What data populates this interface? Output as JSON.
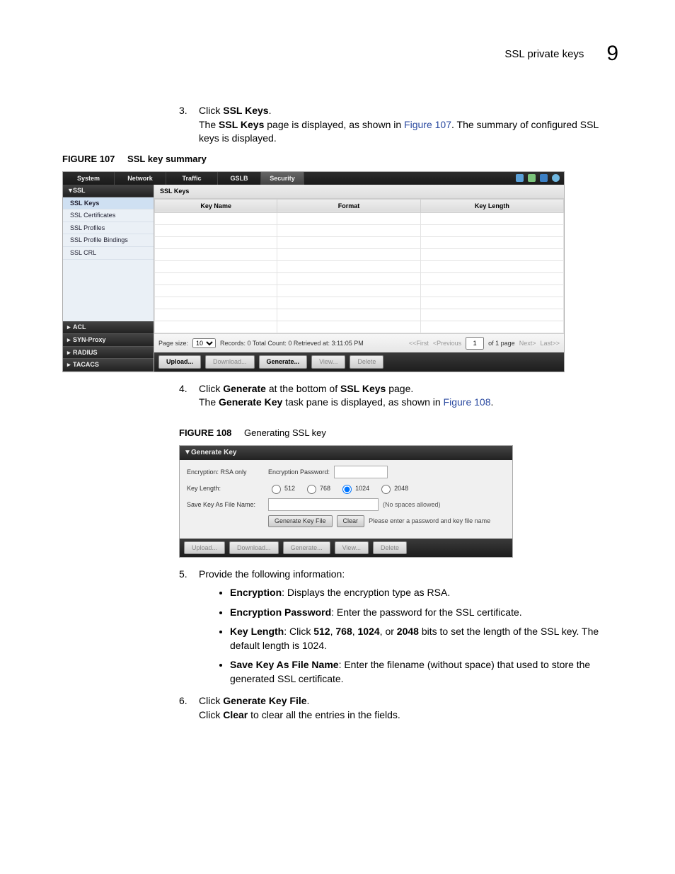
{
  "page_header": {
    "section_title": "SSL private keys",
    "chapter_number": "9"
  },
  "step3": {
    "num": "3.",
    "text_prefix": "Click ",
    "bold": "SSL Keys",
    "suffix": ".",
    "line2_a": "The ",
    "line2_b": "SSL Keys",
    "line2_c": " page is displayed, as shown in ",
    "line2_xref": "Figure 107",
    "line2_d": ". The summary of configured SSL keys is displayed."
  },
  "fig107": {
    "label": "FIGURE 107",
    "title": "SSL key summary",
    "topnav": {
      "tabs": [
        "System",
        "Network",
        "Traffic",
        "GSLB",
        "Security"
      ],
      "active_index": 4
    },
    "sidebar": {
      "sections": [
        {
          "label": "SSL",
          "expanded": true,
          "items": [
            "SSL Keys",
            "SSL Certificates",
            "SSL Profiles",
            "SSL Profile Bindings",
            "SSL CRL"
          ],
          "active_index": 0
        },
        {
          "label": "ACL",
          "expanded": false
        },
        {
          "label": "SYN-Proxy",
          "expanded": false
        },
        {
          "label": "RADIUS",
          "expanded": false
        },
        {
          "label": "TACACS",
          "expanded": false
        }
      ]
    },
    "crumb": "SSL Keys",
    "columns": [
      "Key Name",
      "Format",
      "Key Length"
    ],
    "pager": {
      "page_size_label": "Page size:",
      "page_size_value": "10",
      "status": "Records: 0  Total Count: 0  Retrieved at: 3:11:05 PM",
      "first": "<<First",
      "prev": "<Previous",
      "page_value": "1",
      "of_pages": "of 1 page",
      "next": "Next>",
      "last": "Last>>"
    },
    "toolbar": {
      "upload": "Upload...",
      "download": "Download...",
      "generate": "Generate...",
      "view": "View...",
      "delete": "Delete"
    }
  },
  "step4": {
    "num": "4.",
    "a": "Click ",
    "b": "Generate",
    "c": " at the bottom of ",
    "d": "SSL Keys",
    "e": " page.",
    "line2_a": "The ",
    "line2_b": "Generate Key",
    "line2_c": " task pane is displayed, as shown in ",
    "line2_xref": "Figure 108",
    "line2_d": "."
  },
  "fig108": {
    "label": "FIGURE 108",
    "title": "Generating SSL key",
    "header": "Generate Key",
    "rows": {
      "encryption_label": "Encryption: RSA only",
      "enc_pw_label": "Encryption Password:",
      "key_length_label": "Key Length:",
      "key_length_opts": [
        "512",
        "768",
        "1024",
        "2048"
      ],
      "key_length_selected": 2,
      "save_as_label": "Save Key As File Name:",
      "save_as_note": "(No spaces allowed)",
      "gen_btn": "Generate Key File",
      "clear_btn": "Clear",
      "hint": "Please enter a password and key file name"
    },
    "toolbar": {
      "upload": "Upload...",
      "download": "Download...",
      "generate": "Generate...",
      "view": "View...",
      "delete": "Delete"
    }
  },
  "step5": {
    "num": "5.",
    "intro": "Provide the following information:",
    "bullets": [
      {
        "bold": "Encryption",
        "rest": ": Displays the encryption type as RSA."
      },
      {
        "bold": "Encryption Password",
        "rest": ": Enter the password for the SSL certificate."
      },
      {
        "bold": "Key Length",
        "rest_a": ": Click ",
        "b1": "512",
        "sep1": ", ",
        "b2": "768",
        "sep2": ", ",
        "b3": "1024",
        "sep3": ", or ",
        "b4": "2048",
        "rest_b": " bits to set the length of the SSL key. The default length is 1024."
      },
      {
        "bold": "Save Key As File Name",
        "rest": ": Enter the filename (without space) that used to store the generated SSL certificate."
      }
    ]
  },
  "step6": {
    "num": "6.",
    "a": "Click ",
    "b": "Generate Key File",
    "c": ".",
    "line2_a": "Click ",
    "line2_b": "Clear",
    "line2_c": " to clear all the entries in the fields."
  }
}
